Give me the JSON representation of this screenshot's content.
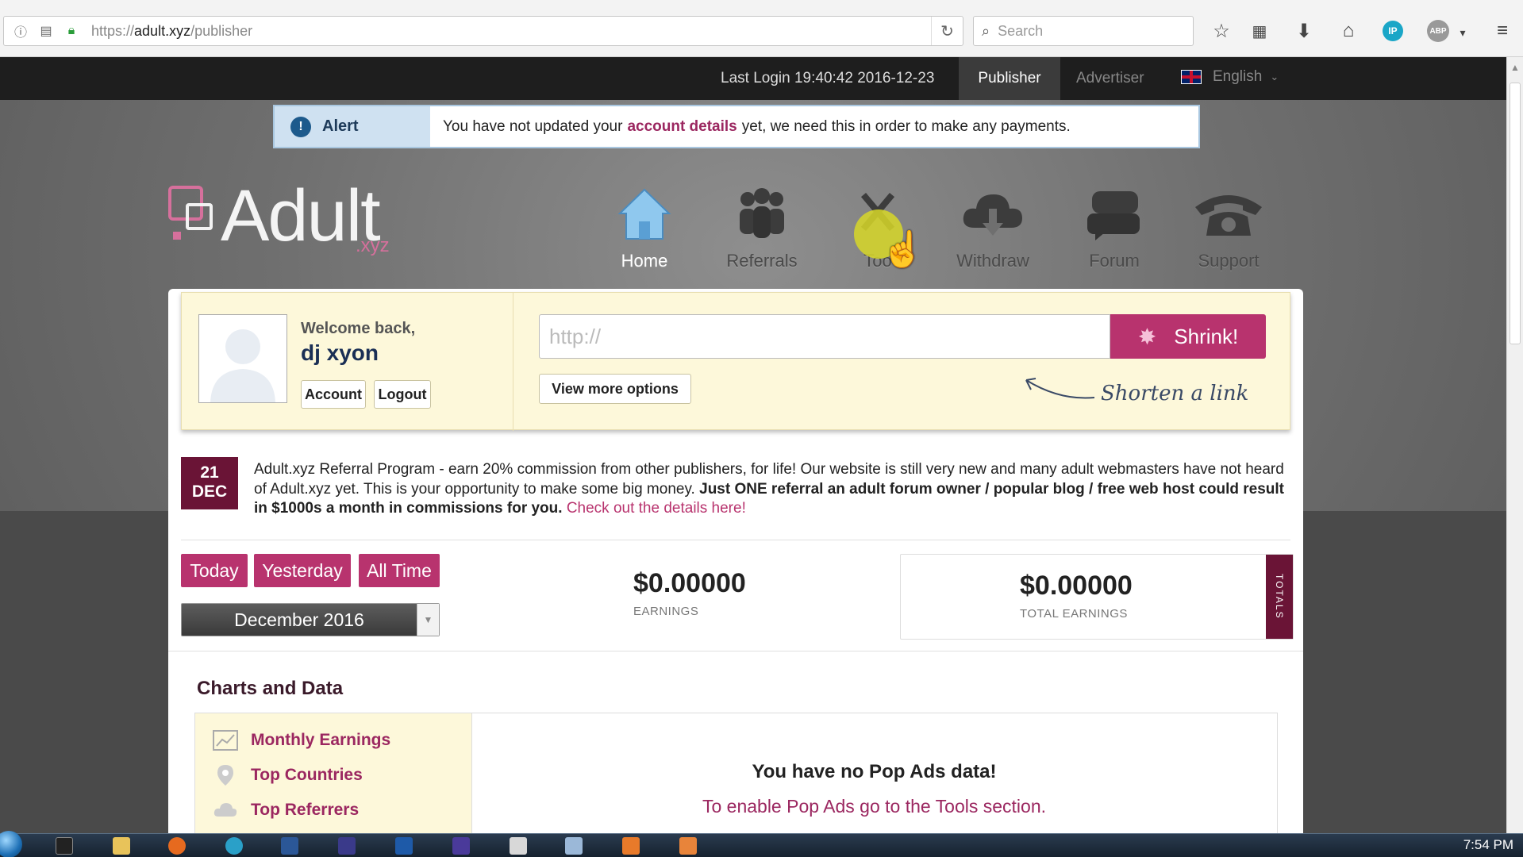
{
  "browser": {
    "url_scheme": "https://",
    "url_host": "adult.xyz",
    "url_path": "/publisher",
    "search_placeholder": "Search",
    "ip_badge": "IP",
    "abp_badge": "ABP"
  },
  "topbar": {
    "last_login": "Last Login 19:40:42 2016-12-23",
    "tab_publisher": "Publisher",
    "tab_advertiser": "Advertiser",
    "language": "English"
  },
  "alert": {
    "label": "Alert",
    "icon": "!",
    "msg_before": "You have not updated your",
    "msg_link": "account details",
    "msg_after": "yet, we need this in order to make any payments."
  },
  "logo": {
    "text": "Adult",
    "sub": ".xyz"
  },
  "nav": {
    "home": "Home",
    "referrals": "Referrals",
    "tools": "Too",
    "withdraw": "Withdraw",
    "forum": "Forum",
    "support": "Support"
  },
  "user": {
    "welcome": "Welcome back,",
    "name": "dj xyon",
    "account_btn": "Account",
    "logout_btn": "Logout"
  },
  "shortener": {
    "placeholder": "http://",
    "shrink_btn": "Shrink!",
    "more_options": "View more options",
    "hint": "Shorten a link"
  },
  "news": {
    "day": "21",
    "month": "DEC",
    "text_plain": "Adult.xyz Referral Program - earn 20% commission from other publishers, for life! Our website is still very new and many adult webmasters have not heard of Adult.xyz yet. This is your opportunity to make some big money.",
    "text_bold": "Just ONE referral an adult forum owner / popular blog / free web host could result in $1000s a month in commissions for you.",
    "text_link": "Check out the details here!"
  },
  "stats": {
    "btn_today": "Today",
    "btn_yesterday": "Yesterday",
    "btn_alltime": "All Time",
    "month": "December 2016",
    "earnings": "$0.00000",
    "earnings_label": "EARNINGS",
    "total_earnings": "$0.00000",
    "total_label": "TOTAL EARNINGS",
    "totals_tab": "TOTALS"
  },
  "charts": {
    "title": "Charts and Data",
    "menu": [
      "Monthly Earnings",
      "Top Countries",
      "Top Referrers"
    ],
    "no_data": "You have no Pop Ads data!",
    "enable_hint": "To enable Pop Ads go to the Tools section."
  },
  "taskbar": {
    "clock": "7:54 PM"
  }
}
